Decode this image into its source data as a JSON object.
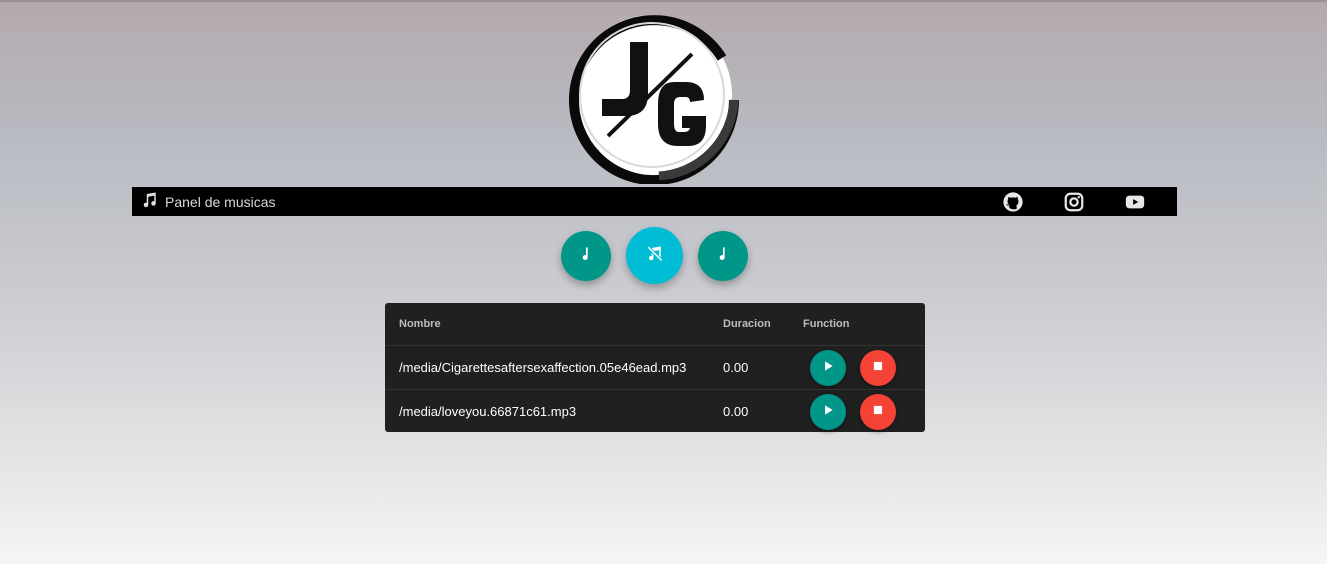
{
  "navbar": {
    "brand_label": "Panel de musicas",
    "brand_icon": "music-note-icon",
    "links": [
      {
        "name": "github",
        "icon": "github-icon"
      },
      {
        "name": "instagram",
        "icon": "instagram-icon"
      },
      {
        "name": "youtube",
        "icon": "youtube-icon"
      }
    ]
  },
  "controls": [
    {
      "icon": "music-note-icon",
      "color": "#009688"
    },
    {
      "icon": "music-off-icon",
      "color": "#00bcd4"
    },
    {
      "icon": "music-note-icon",
      "color": "#009688"
    }
  ],
  "table": {
    "headers": {
      "name": "Nombre",
      "duration": "Duracion",
      "function": "Function"
    },
    "rows": [
      {
        "name": "/media/Cigarettesaftersexaffection.05e46ead.mp3",
        "duration": "0.00"
      },
      {
        "name": "/media/loveyou.66871c61.mp3",
        "duration": "0.00"
      }
    ],
    "play_color": "#009688",
    "stop_color": "#f44336"
  }
}
